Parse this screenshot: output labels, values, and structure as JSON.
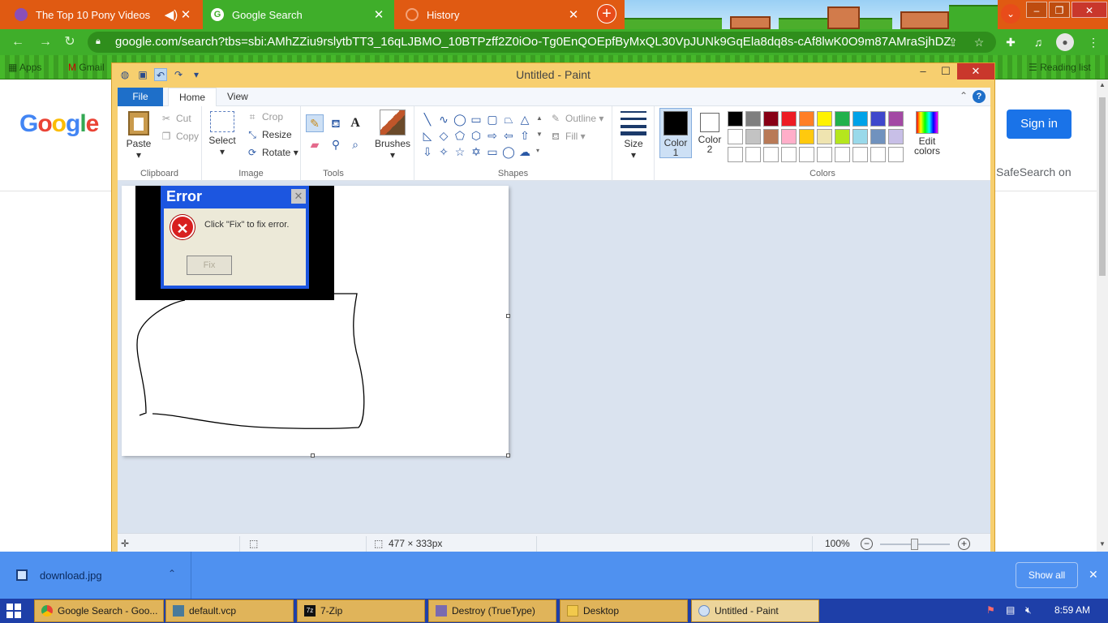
{
  "browser": {
    "tabs": [
      {
        "label": "The Top 10 Pony Videos",
        "active": false,
        "audio": true
      },
      {
        "label": "Google Search",
        "active": true
      },
      {
        "label": "History",
        "active": false
      }
    ],
    "new_tab": "+",
    "url": "google.com/search?tbs=sbi:AMhZZiu9rslytbTT3_16qLJBMO_10BTPzff2Z0iOo-Tg0EnQOEpfByMxQL30VpJUNk9GqEla8dq8s-cAf8lwK0O9m87AMraSjhDZJrri4ddz7y_1...",
    "bookmarks": [
      "Apps",
      "Gmail"
    ],
    "reading_list": "Reading list"
  },
  "google": {
    "logo_letters": [
      "G",
      "o",
      "o",
      "g",
      "l",
      "e"
    ],
    "sign_in": "Sign in",
    "safesearch": "SafeSearch on"
  },
  "paint": {
    "title": "Untitled - Paint",
    "tabs": {
      "file": "File",
      "home": "Home",
      "view": "View"
    },
    "clipboard": {
      "paste": "Paste",
      "cut": "Cut",
      "copy": "Copy",
      "label": "Clipboard"
    },
    "image": {
      "select": "Select",
      "crop": "Crop",
      "resize": "Resize",
      "rotate": "Rotate",
      "label": "Image"
    },
    "tools": {
      "label": "Tools"
    },
    "brushes": {
      "label": "Brushes"
    },
    "shapes": {
      "outline": "Outline",
      "fill": "Fill",
      "label": "Shapes"
    },
    "size": {
      "label": "Size"
    },
    "colors": {
      "color1": "Color 1",
      "color2": "Color 2",
      "edit": "Edit colors",
      "label": "Colors",
      "palette": [
        "#000000",
        "#7f7f7f",
        "#880015",
        "#ed1c24",
        "#ff7f27",
        "#fff200",
        "#22b14c",
        "#00a2e8",
        "#3f48cc",
        "#a349a4",
        "#ffffff",
        "#c3c3c3",
        "#b97a57",
        "#ffaec9",
        "#ffc90e",
        "#efe4b0",
        "#b5e61d",
        "#99d9ea",
        "#7092be",
        "#c8bfe7",
        "#ffffff",
        "#ffffff",
        "#ffffff",
        "#ffffff",
        "#ffffff",
        "#ffffff",
        "#ffffff",
        "#ffffff",
        "#ffffff",
        "#ffffff"
      ]
    },
    "canvas_image": {
      "error_title": "Error",
      "error_message": "Click \"Fix\" to fix error.",
      "fix_button": "Fix"
    },
    "status": {
      "dimensions": "477 × 333px",
      "zoom": "100%"
    }
  },
  "downloads": {
    "file": "download.jpg",
    "show_all": "Show all"
  },
  "taskbar": {
    "items": [
      {
        "label": "Google Search - Goo..."
      },
      {
        "label": "default.vcp"
      },
      {
        "label": "7-Zip"
      },
      {
        "label": "Destroy (TrueType)"
      },
      {
        "label": "Desktop"
      },
      {
        "label": "Untitled - Paint"
      }
    ],
    "time": "8:59 AM"
  }
}
